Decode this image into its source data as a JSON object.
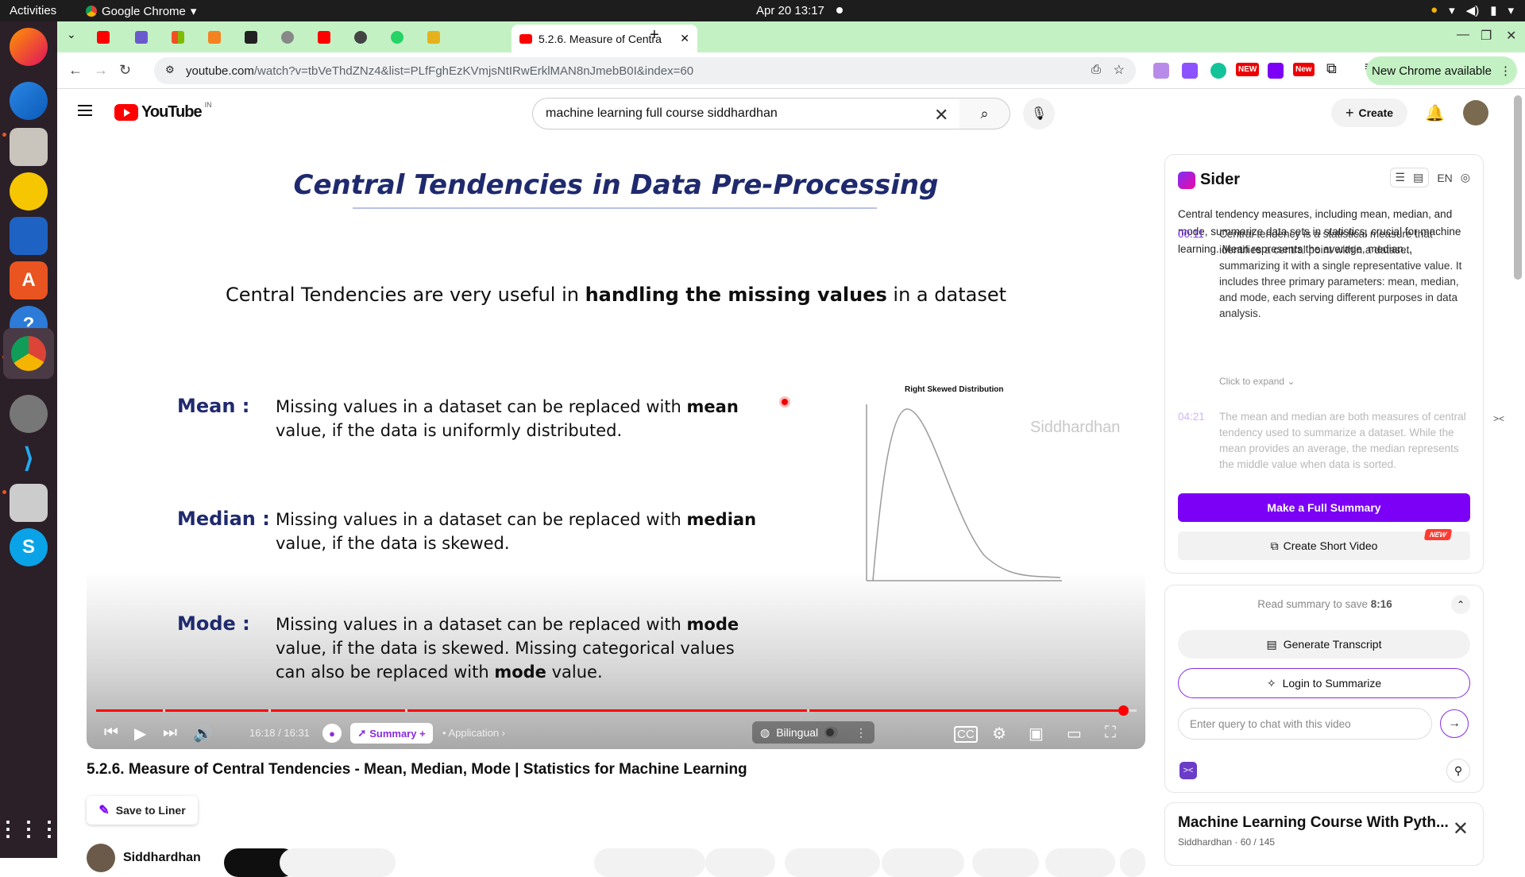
{
  "os": {
    "activities": "Activities",
    "app_name": "Google Chrome",
    "clock": "Apr 20  13:17"
  },
  "browser": {
    "active_tab_title": "5.2.6. Measure of Centra",
    "url_host": "youtube.com",
    "url_path": "/watch?v=tbVeThdZNz4&list=PLfFghEzKVmjsNtIRwErklMAN8nJmebB0I&index=60",
    "new_chrome_label": "New Chrome available",
    "new_badge_1": "NEW",
    "new_badge_2": "New"
  },
  "youtube": {
    "logo_text": "YouTube",
    "country_code": "IN",
    "search_query": "machine learning full course siddhardhan",
    "create_label": "Create"
  },
  "slide": {
    "title": "Central Tendencies in Data Pre-Processing",
    "subtitle_pre": "Central Tendencies are very useful in ",
    "subtitle_bold": "handling the missing values",
    "subtitle_post": " in a dataset",
    "mean_term": "Mean :",
    "mean_desc_pre": "Missing values in a dataset can be replaced with ",
    "mean_desc_bold": "mean",
    "mean_desc_post": " value, if the data is uniformly distributed.",
    "median_term": "Median :",
    "median_desc_pre": "Missing values in a dataset can be replaced with ",
    "median_desc_bold": "median",
    "median_desc_post": " value, if the data is skewed.",
    "mode_term": "Mode :",
    "mode_desc_pre": "Missing values in a dataset can be replaced with ",
    "mode_desc_bold": "mode",
    "mode_desc_mid": " value, if the data is skewed. Missing categorical values can also be replaced with ",
    "mode_desc_bold2": "mode",
    "mode_desc_post": " value.",
    "chart_title": "Right Skewed Distribution",
    "watermark": "Siddhardhan"
  },
  "player": {
    "time": "16:18 / 16:31",
    "progress": 0.987,
    "chapter_marks": [
      0.064,
      0.166,
      0.297,
      0.683
    ],
    "summary_label": "Summary +",
    "chapter_label": "• Application",
    "bilingual_label": "Bilingual"
  },
  "video": {
    "title": "5.2.6. Measure of Central Tendencies - Mean, Median, Mode | Statistics for Machine Learning",
    "save_liner": "Save to Liner",
    "channel": "Siddhardhan"
  },
  "sider": {
    "brand": "Sider",
    "lang": "EN",
    "intro": "Central tendency measures, including mean, median, and mode, summarize data sets in statistics, crucial for machine learning. Mean represents the average, median...",
    "items": [
      {
        "ts": "00:11",
        "text": "Central tendency is a statistical measure that identifies a central point within a dataset, summarizing it with a single representative value. It includes three primary parameters: mean, median, and mode, each serving different purposes in data analysis."
      },
      {
        "ts": "04:21",
        "text": "The mean and median are both measures of central tendency used to summarize a dataset. While the mean provides an average, the median represents the middle value when data is sorted."
      }
    ],
    "expand": "Click to expand ⌄",
    "full_summary": "Make a Full Summary",
    "short_video": "Create Short Video",
    "short_video_badge": "NEW",
    "read_summary_pre": "Read summary to save ",
    "read_summary_time": "8:16",
    "generate_transcript": "Generate Transcript",
    "login_summarize": "Login to Summarize",
    "chat_placeholder": "Enter query to chat with this video"
  },
  "playlist": {
    "title": "Machine Learning Course With Pyth...",
    "meta": "Siddhardhan · 60 / 145"
  },
  "colors": {
    "accent_purple": "#7b00f5",
    "youtube_red": "#ff0000",
    "tab_strip": "#c4f1c4",
    "slide_navy": "#1f2a6e"
  }
}
